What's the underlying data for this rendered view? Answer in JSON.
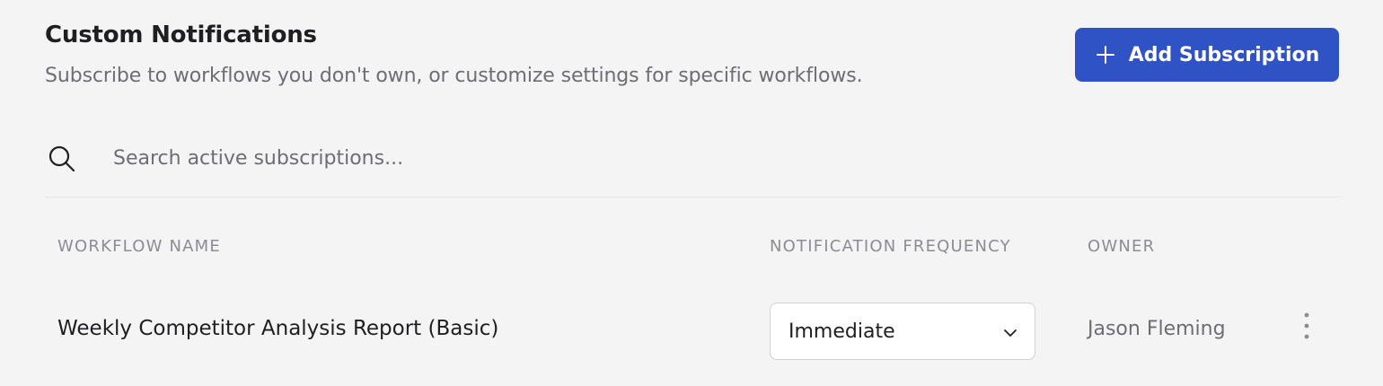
{
  "header": {
    "title": "Custom Notifications",
    "subtitle": "Subscribe to workflows you don't own, or customize settings for specific workflows.",
    "add_button_label": "Add Subscription"
  },
  "search": {
    "placeholder": "Search active subscriptions...",
    "value": ""
  },
  "table": {
    "columns": [
      "Workflow Name",
      "Notification Frequency",
      "Owner"
    ],
    "rows": [
      {
        "workflow_name": "Weekly Competitor Analysis Report (Basic)",
        "frequency": "Immediate",
        "owner": "Jason Fleming"
      }
    ]
  },
  "colors": {
    "accent": "#2f52c4",
    "background": "#f4f4f5",
    "muted_text": "#6d6d73",
    "header_text": "#8c8c92"
  },
  "icons": {
    "add": "plus-icon",
    "search": "search-icon",
    "dropdown": "chevron-down-icon",
    "row_menu": "more-vertical-icon"
  }
}
